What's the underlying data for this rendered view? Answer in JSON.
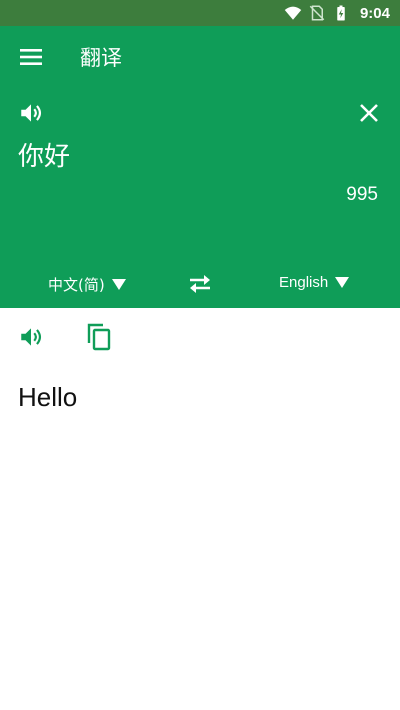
{
  "status_bar": {
    "time": "9:04",
    "icons": [
      "wifi-icon",
      "no-sim-icon",
      "battery-charging-icon"
    ]
  },
  "header": {
    "title": "翻译",
    "menu_icon": "menu-icon"
  },
  "input": {
    "text": "你好",
    "char_count": "995",
    "speak_icon": "volume-icon",
    "clear_icon": "close-icon"
  },
  "languages": {
    "source": "中文(简)",
    "target": "English",
    "swap_icon": "swap-arrows-icon"
  },
  "output": {
    "text": "Hello",
    "speak_icon": "volume-icon",
    "copy_icon": "copy-icon"
  },
  "colors": {
    "status_bar": "#3d7d3d",
    "primary": "#0f9d58",
    "text_on_primary": "#ffffff",
    "result_text": "#111111"
  }
}
